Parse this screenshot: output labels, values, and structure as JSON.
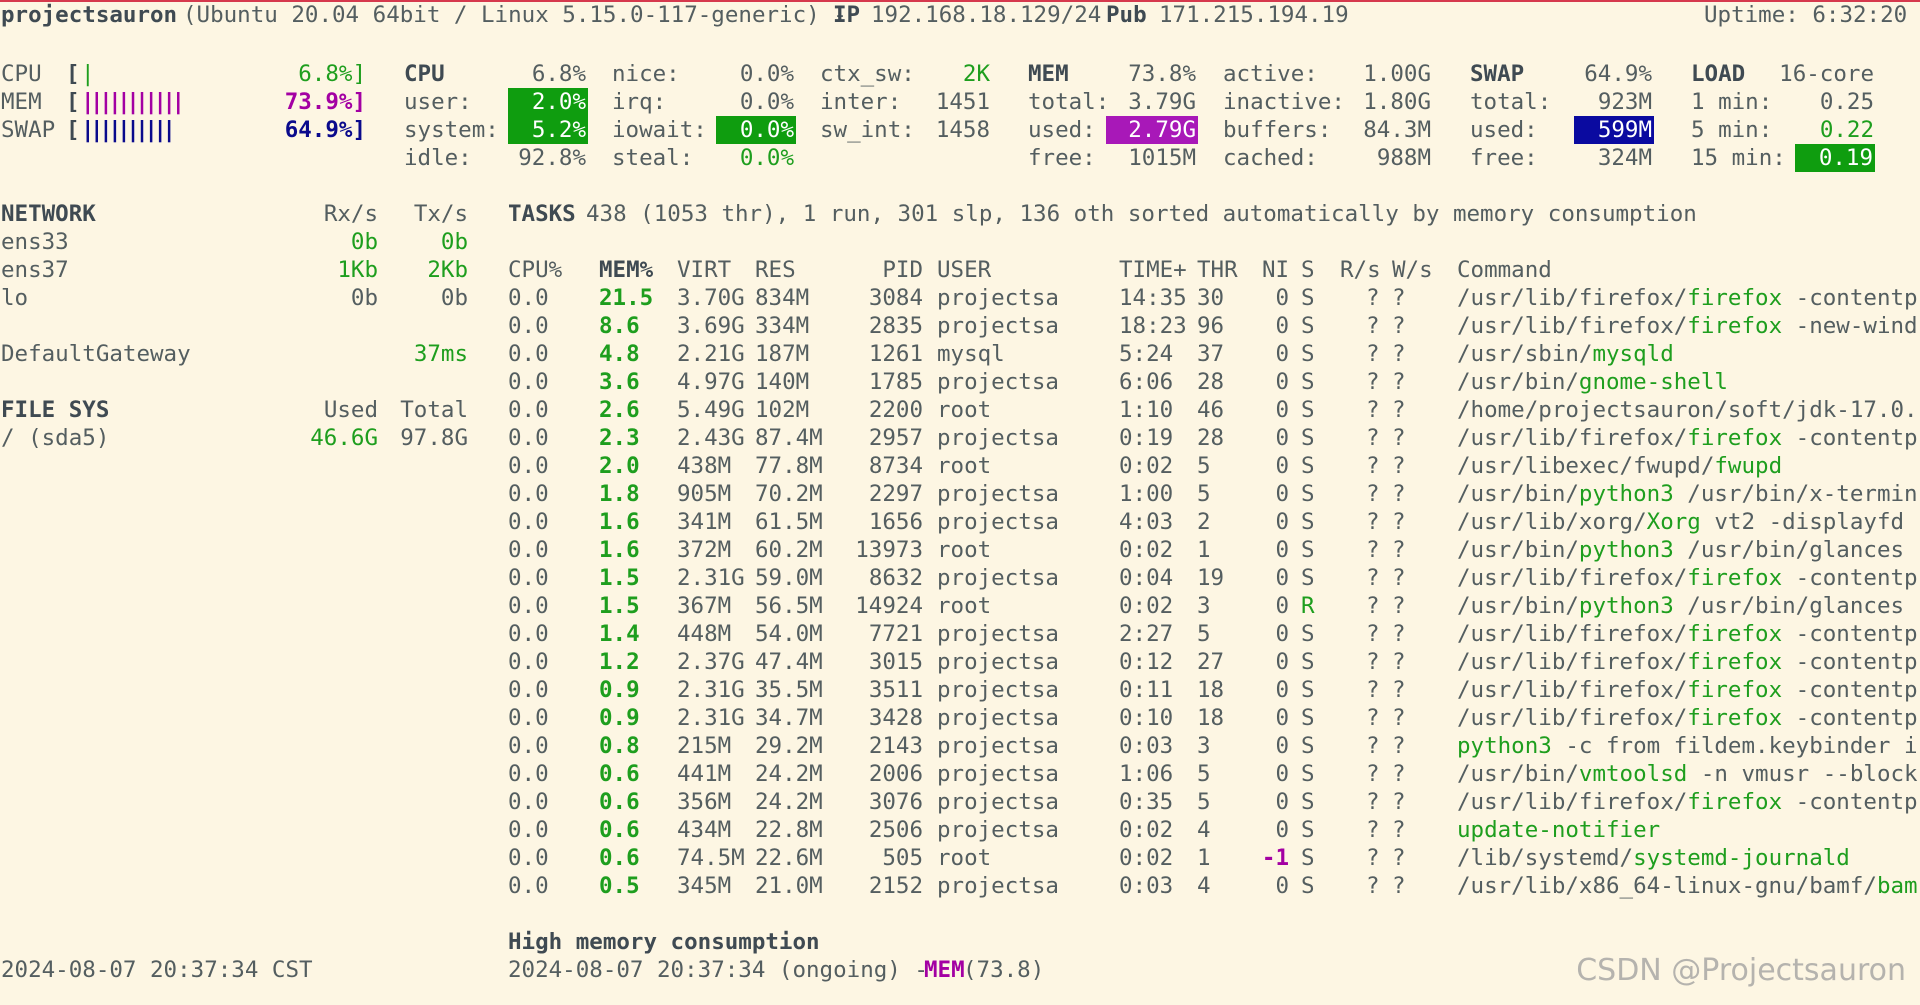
{
  "header": {
    "hostname": "projectsauron",
    "os_info": "(Ubuntu 20.04 64bit / Linux 5.15.0-117-generic) -",
    "ip_label": "IP",
    "ip_value": "192.168.18.129/24",
    "pub_label": "Pub",
    "pub_value": "171.215.194.19",
    "uptime": "Uptime: 6:32:20"
  },
  "quicklook": {
    "cpu": {
      "label": "CPU",
      "bar": "|",
      "value": "6.8%]"
    },
    "mem": {
      "label": "MEM",
      "bar": "|||||||||||",
      "value": "73.9%]"
    },
    "swap": {
      "label": "SWAP",
      "bar": "||||||||||",
      "value": "64.9%]"
    }
  },
  "cpu": {
    "title": "CPU",
    "total": "6.8%",
    "user_label": "user:",
    "user": "2.0%",
    "system_label": "system:",
    "system": "5.2%",
    "idle_label": "idle:",
    "idle": "92.8%",
    "nice_label": "nice:",
    "nice": "0.0%",
    "irq_label": "irq:",
    "irq": "0.0%",
    "iowait_label": "iowait:",
    "iowait": "0.0%",
    "steal_label": "steal:",
    "steal": "0.0%",
    "ctx_label": "ctx_sw:",
    "ctx": "2K",
    "inter_label": "inter:",
    "inter": "1451",
    "swint_label": "sw_int:",
    "swint": "1458"
  },
  "mem": {
    "title": "MEM",
    "pct": "73.8%",
    "total_label": "total:",
    "total": "3.79G",
    "used_label": "used:",
    "used": "2.79G",
    "free_label": "free:",
    "free": "1015M",
    "active_label": "active:",
    "active": "1.00G",
    "inactive_label": "inactive:",
    "inactive": "1.80G",
    "buffers_label": "buffers:",
    "buffers": "84.3M",
    "cached_label": "cached:",
    "cached": "988M"
  },
  "swap": {
    "title": "SWAP",
    "pct": "64.9%",
    "total_label": "total:",
    "total": "923M",
    "used_label": "used:",
    "used": "599M",
    "free_label": "free:",
    "free": "324M"
  },
  "load": {
    "title": "LOAD",
    "cores": "16-core",
    "min1_label": "1 min:",
    "min1": "0.25",
    "min5_label": "5 min:",
    "min5": "0.22",
    "min15_label": "15 min:",
    "min15": "0.19"
  },
  "network": {
    "title": "NETWORK",
    "rx_header": "Rx/s",
    "tx_header": "Tx/s",
    "interfaces": [
      {
        "name": "ens33",
        "rx": "0b",
        "tx": "0b"
      },
      {
        "name": "ens37",
        "rx": "1Kb",
        "tx": "2Kb"
      },
      {
        "name": "lo",
        "rx": "0b",
        "tx": "0b"
      }
    ],
    "gateway_label": "DefaultGateway",
    "gateway_value": "37ms"
  },
  "filesys": {
    "title": "FILE SYS",
    "used_header": "Used",
    "total_header": "Total",
    "mount": "/ (sda5)",
    "used": "46.6G",
    "total": "97.8G"
  },
  "tasks": {
    "title": "TASKS",
    "summary": "438 (1053 thr), 1 run, 301 slp, 136 oth sorted automatically by memory consumption"
  },
  "process_table": {
    "headers": {
      "cpu": "CPU%",
      "mem": "MEM%",
      "virt": "VIRT",
      "res": "RES",
      "pid": "PID",
      "user": "USER",
      "time": "TIME+",
      "thr": "THR",
      "ni": "NI",
      "s": "S",
      "rs": "R/s",
      "ws": "W/s",
      "command": "Command"
    },
    "rows": [
      {
        "cpu": "0.0",
        "mem": "21.5",
        "virt": "3.70G",
        "res": "834M",
        "pid": "3084",
        "user": "projectsa",
        "time": "14:35",
        "thr": "30",
        "ni": "0",
        "s": "S",
        "rs": "?",
        "ws": "?",
        "cmd_pre": "/usr/lib/firefox/",
        "cmd_hi": "firefox",
        "cmd_post": " -contentp"
      },
      {
        "cpu": "0.0",
        "mem": "8.6",
        "virt": "3.69G",
        "res": "334M",
        "pid": "2835",
        "user": "projectsa",
        "time": "18:23",
        "thr": "96",
        "ni": "0",
        "s": "S",
        "rs": "?",
        "ws": "?",
        "cmd_pre": "/usr/lib/firefox/",
        "cmd_hi": "firefox",
        "cmd_post": " -new-wind"
      },
      {
        "cpu": "0.0",
        "mem": "4.8",
        "virt": "2.21G",
        "res": "187M",
        "pid": "1261",
        "user": "mysql",
        "time": "5:24",
        "thr": "37",
        "ni": "0",
        "s": "S",
        "rs": "?",
        "ws": "?",
        "cmd_pre": "/usr/sbin/",
        "cmd_hi": "mysqld",
        "cmd_post": ""
      },
      {
        "cpu": "0.0",
        "mem": "3.6",
        "virt": "4.97G",
        "res": "140M",
        "pid": "1785",
        "user": "projectsa",
        "time": "6:06",
        "thr": "28",
        "ni": "0",
        "s": "S",
        "rs": "?",
        "ws": "?",
        "cmd_pre": "/usr/bin/",
        "cmd_hi": "gnome-shell",
        "cmd_post": ""
      },
      {
        "cpu": "0.0",
        "mem": "2.6",
        "virt": "5.49G",
        "res": "102M",
        "pid": "2200",
        "user": "root",
        "time": "1:10",
        "thr": "46",
        "ni": "0",
        "s": "S",
        "rs": "?",
        "ws": "?",
        "cmd_pre": "/home/projectsauron/soft/jdk-17.0.",
        "cmd_hi": "",
        "cmd_post": ""
      },
      {
        "cpu": "0.0",
        "mem": "2.3",
        "virt": "2.43G",
        "res": "87.4M",
        "pid": "2957",
        "user": "projectsa",
        "time": "0:19",
        "thr": "28",
        "ni": "0",
        "s": "S",
        "rs": "?",
        "ws": "?",
        "cmd_pre": "/usr/lib/firefox/",
        "cmd_hi": "firefox",
        "cmd_post": " -contentp"
      },
      {
        "cpu": "0.0",
        "mem": "2.0",
        "virt": "438M",
        "res": "77.8M",
        "pid": "8734",
        "user": "root",
        "time": "0:02",
        "thr": "5",
        "ni": "0",
        "s": "S",
        "rs": "?",
        "ws": "?",
        "cmd_pre": "/usr/libexec/fwupd/",
        "cmd_hi": "fwupd",
        "cmd_post": ""
      },
      {
        "cpu": "0.0",
        "mem": "1.8",
        "virt": "905M",
        "res": "70.2M",
        "pid": "2297",
        "user": "projectsa",
        "time": "1:00",
        "thr": "5",
        "ni": "0",
        "s": "S",
        "rs": "?",
        "ws": "?",
        "cmd_pre": "/usr/bin/",
        "cmd_hi": "python3",
        "cmd_post": " /usr/bin/x-termin"
      },
      {
        "cpu": "0.0",
        "mem": "1.6",
        "virt": "341M",
        "res": "61.5M",
        "pid": "1656",
        "user": "projectsa",
        "time": "4:03",
        "thr": "2",
        "ni": "0",
        "s": "S",
        "rs": "?",
        "ws": "?",
        "cmd_pre": "/usr/lib/xorg/",
        "cmd_hi": "Xorg",
        "cmd_post": " vt2 -displayfd"
      },
      {
        "cpu": "0.0",
        "mem": "1.6",
        "virt": "372M",
        "res": "60.2M",
        "pid": "13973",
        "user": "root",
        "time": "0:02",
        "thr": "1",
        "ni": "0",
        "s": "S",
        "rs": "?",
        "ws": "?",
        "cmd_pre": "/usr/bin/",
        "cmd_hi": "python3",
        "cmd_post": " /usr/bin/glances"
      },
      {
        "cpu": "0.0",
        "mem": "1.5",
        "virt": "2.31G",
        "res": "59.0M",
        "pid": "8632",
        "user": "projectsa",
        "time": "0:04",
        "thr": "19",
        "ni": "0",
        "s": "S",
        "rs": "?",
        "ws": "?",
        "cmd_pre": "/usr/lib/firefox/",
        "cmd_hi": "firefox",
        "cmd_post": " -contentp"
      },
      {
        "cpu": "0.0",
        "mem": "1.5",
        "virt": "367M",
        "res": "56.5M",
        "pid": "14924",
        "user": "root",
        "time": "0:02",
        "thr": "3",
        "ni": "0",
        "s": "R",
        "rs": "?",
        "ws": "?",
        "cmd_pre": "/usr/bin/",
        "cmd_hi": "python3",
        "cmd_post": " /usr/bin/glances"
      },
      {
        "cpu": "0.0",
        "mem": "1.4",
        "virt": "448M",
        "res": "54.0M",
        "pid": "7721",
        "user": "projectsa",
        "time": "2:27",
        "thr": "5",
        "ni": "0",
        "s": "S",
        "rs": "?",
        "ws": "?",
        "cmd_pre": "/usr/lib/firefox/",
        "cmd_hi": "firefox",
        "cmd_post": " -contentp"
      },
      {
        "cpu": "0.0",
        "mem": "1.2",
        "virt": "2.37G",
        "res": "47.4M",
        "pid": "3015",
        "user": "projectsa",
        "time": "0:12",
        "thr": "27",
        "ni": "0",
        "s": "S",
        "rs": "?",
        "ws": "?",
        "cmd_pre": "/usr/lib/firefox/",
        "cmd_hi": "firefox",
        "cmd_post": " -contentp"
      },
      {
        "cpu": "0.0",
        "mem": "0.9",
        "virt": "2.31G",
        "res": "35.5M",
        "pid": "3511",
        "user": "projectsa",
        "time": "0:11",
        "thr": "18",
        "ni": "0",
        "s": "S",
        "rs": "?",
        "ws": "?",
        "cmd_pre": "/usr/lib/firefox/",
        "cmd_hi": "firefox",
        "cmd_post": " -contentp"
      },
      {
        "cpu": "0.0",
        "mem": "0.9",
        "virt": "2.31G",
        "res": "34.7M",
        "pid": "3428",
        "user": "projectsa",
        "time": "0:10",
        "thr": "18",
        "ni": "0",
        "s": "S",
        "rs": "?",
        "ws": "?",
        "cmd_pre": "/usr/lib/firefox/",
        "cmd_hi": "firefox",
        "cmd_post": " -contentp"
      },
      {
        "cpu": "0.0",
        "mem": "0.8",
        "virt": "215M",
        "res": "29.2M",
        "pid": "2143",
        "user": "projectsa",
        "time": "0:03",
        "thr": "3",
        "ni": "0",
        "s": "S",
        "rs": "?",
        "ws": "?",
        "cmd_pre": "",
        "cmd_hi": "python3",
        "cmd_post": " -c from fildem.keybinder i"
      },
      {
        "cpu": "0.0",
        "mem": "0.6",
        "virt": "441M",
        "res": "24.2M",
        "pid": "2006",
        "user": "projectsa",
        "time": "1:06",
        "thr": "5",
        "ni": "0",
        "s": "S",
        "rs": "?",
        "ws": "?",
        "cmd_pre": "/usr/bin/",
        "cmd_hi": "vmtoolsd",
        "cmd_post": " -n vmusr --block"
      },
      {
        "cpu": "0.0",
        "mem": "0.6",
        "virt": "356M",
        "res": "24.2M",
        "pid": "3076",
        "user": "projectsa",
        "time": "0:35",
        "thr": "5",
        "ni": "0",
        "s": "S",
        "rs": "?",
        "ws": "?",
        "cmd_pre": "/usr/lib/firefox/",
        "cmd_hi": "firefox",
        "cmd_post": " -contentp"
      },
      {
        "cpu": "0.0",
        "mem": "0.6",
        "virt": "434M",
        "res": "22.8M",
        "pid": "2506",
        "user": "projectsa",
        "time": "0:02",
        "thr": "4",
        "ni": "0",
        "s": "S",
        "rs": "?",
        "ws": "?",
        "cmd_pre": "",
        "cmd_hi": "update-notifier",
        "cmd_post": ""
      },
      {
        "cpu": "0.0",
        "mem": "0.6",
        "virt": "74.5M",
        "res": "22.6M",
        "pid": "505",
        "user": "root",
        "time": "0:02",
        "thr": "1",
        "ni": "-1",
        "s": "S",
        "rs": "?",
        "ws": "?",
        "cmd_pre": "/lib/systemd/",
        "cmd_hi": "systemd-journald",
        "cmd_post": ""
      },
      {
        "cpu": "0.0",
        "mem": "0.5",
        "virt": "345M",
        "res": "21.0M",
        "pid": "2152",
        "user": "projectsa",
        "time": "0:03",
        "thr": "4",
        "ni": "0",
        "s": "S",
        "rs": "?",
        "ws": "?",
        "cmd_pre": "/usr/lib/x86_64-linux-gnu/bamf/",
        "cmd_hi": "bam",
        "cmd_post": ""
      }
    ]
  },
  "alert": {
    "title": "High memory consumption",
    "time": "2024-08-07 20:37:34 (ongoing) -",
    "type": "MEM",
    "value": "(73.8)"
  },
  "footer": {
    "datetime": "2024-08-07 20:37:34 CST",
    "watermark": "CSDN @Projectsauron"
  },
  "colors": {
    "background": "#fdf6e3",
    "ok_green": "#1e9e1e",
    "warning_magenta": "#a300a3",
    "careful_blue": "#0a0a8c",
    "top_border": "#d6394d"
  }
}
